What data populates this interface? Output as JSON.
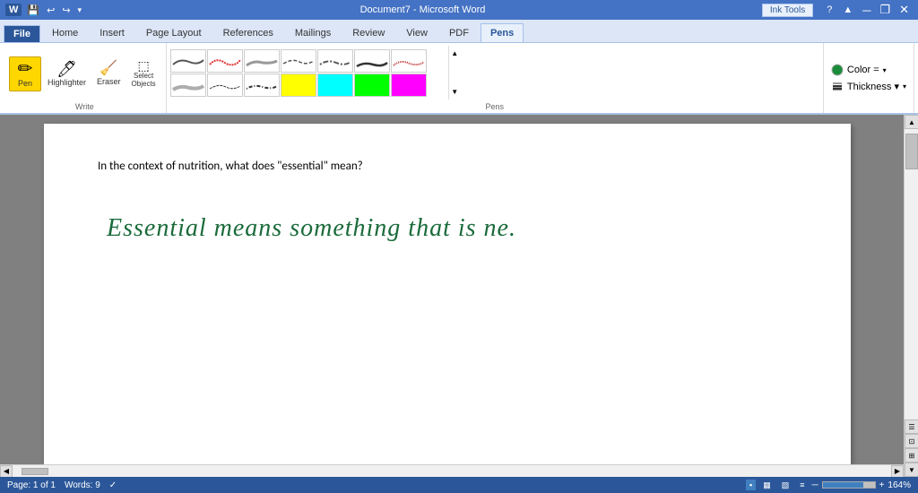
{
  "titleBar": {
    "title": "Document7 - Microsoft Word",
    "inkToolsLabel": "Ink Tools",
    "minBtn": "─",
    "restoreBtn": "❐",
    "closeBtn": "✕"
  },
  "quickAccess": {
    "icons": [
      "💾",
      "↩",
      "↪"
    ]
  },
  "ribbonTabs": [
    {
      "id": "file",
      "label": "File",
      "active": false
    },
    {
      "id": "home",
      "label": "Home",
      "active": false
    },
    {
      "id": "insert",
      "label": "Insert",
      "active": false
    },
    {
      "id": "pagelayout",
      "label": "Page Layout",
      "active": false
    },
    {
      "id": "references",
      "label": "References",
      "active": false
    },
    {
      "id": "mailings",
      "label": "Mailings",
      "active": false
    },
    {
      "id": "review",
      "label": "Review",
      "active": false
    },
    {
      "id": "view",
      "label": "View",
      "active": false
    },
    {
      "id": "acrobat",
      "label": "PDF",
      "active": false
    },
    {
      "id": "pens",
      "label": "Pens",
      "active": true
    }
  ],
  "writeGroup": {
    "label": "Write",
    "tools": [
      {
        "id": "pen",
        "label": "Pen",
        "icon": "✏️",
        "active": true
      },
      {
        "id": "highlighter",
        "label": "Highlighter",
        "icon": "🖊",
        "active": false
      },
      {
        "id": "eraser",
        "label": "Eraser",
        "icon": "⬜",
        "active": false
      },
      {
        "id": "select",
        "label": "Select\nObjects",
        "icon": "⬛",
        "active": false
      }
    ]
  },
  "pensGroup": {
    "label": "Pens"
  },
  "colorGroup": {
    "colorLabel": "Color =",
    "thicknessLabel": "Thickness ▾"
  },
  "document": {
    "question": "In the context of nutrition, what does \"essential\" mean?",
    "handwrittenText": "Essential means something that is ne."
  },
  "statusBar": {
    "page": "Page: 1 of 1",
    "words": "Words: 9",
    "zoomLevel": "164%",
    "zoomMinus": "─",
    "zoomPlus": "+"
  }
}
